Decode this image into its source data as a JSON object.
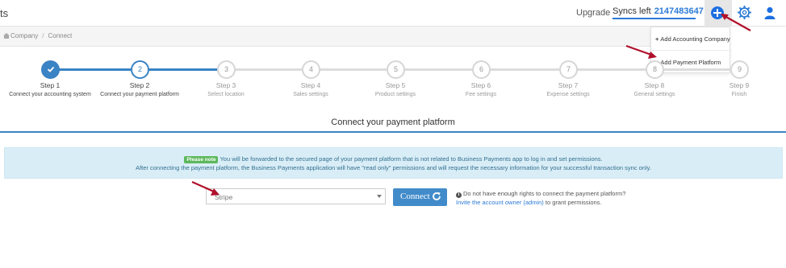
{
  "header": {
    "app_title": "ts",
    "upgrade_label": "Upgrade",
    "syncs_label": "Syncs left",
    "syncs_value": "2147483647",
    "icons": [
      "plus-circle-icon",
      "gear-icon",
      "user-icon"
    ],
    "accent_color": "#1d6fe0"
  },
  "dropdown": {
    "items": [
      {
        "label": "Add Accounting Company"
      },
      {
        "label": "Add Payment Platform"
      }
    ]
  },
  "breadcrumb": {
    "items": [
      "Company",
      "Connect"
    ],
    "separator": "/"
  },
  "steps": [
    {
      "title": "Step 1",
      "number": "1",
      "desc": "Connect your accounting system",
      "state": "done"
    },
    {
      "title": "Step 2",
      "number": "2",
      "desc": "Connect your payment platform",
      "state": "active"
    },
    {
      "title": "Step 3",
      "number": "3",
      "desc": "Select location",
      "state": "todo"
    },
    {
      "title": "Step 4",
      "number": "4",
      "desc": "Sales settings",
      "state": "todo"
    },
    {
      "title": "Step 5",
      "number": "5",
      "desc": "Product settings",
      "state": "todo"
    },
    {
      "title": "Step 6",
      "number": "6",
      "desc": "Fee settings",
      "state": "todo"
    },
    {
      "title": "Step 7",
      "number": "7",
      "desc": "Expense settings",
      "state": "todo"
    },
    {
      "title": "Step 8",
      "number": "8",
      "desc": "General settings",
      "state": "todo"
    },
    {
      "title": "Step 9",
      "number": "9",
      "desc": "Finish",
      "state": "todo"
    }
  ],
  "main": {
    "heading": "Connect your payment platform",
    "note_badge": "Please note",
    "note_line1": "You will be forwarded to the secured page of your payment platform that is not related to Business Payments app to log in and set permissions.",
    "note_line2": "After connecting the payment platform, the Business Payments application will have \"read only\" permissions and will request the necessary information for your successful transaction sync only.",
    "select_value": "Stripe",
    "connect_label": "Connect",
    "rights_line1": "Do not have enough rights to connect the payment platform?",
    "rights_line2_prefix": "Invite the account owner (admin)",
    "rights_line2_suffix": " to grant permissions."
  }
}
